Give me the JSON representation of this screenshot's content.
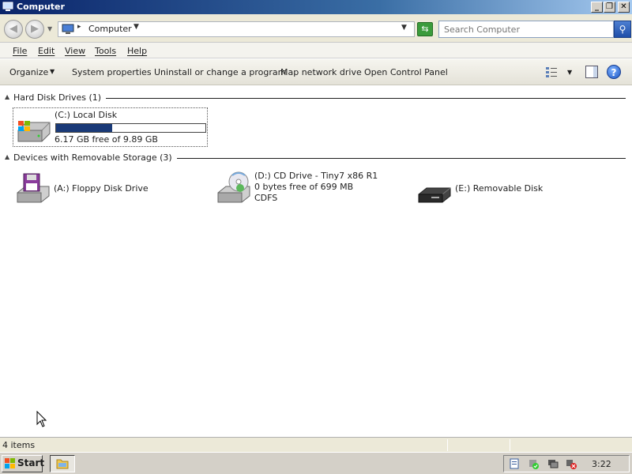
{
  "window": {
    "title": "Computer",
    "min_glyph": "_",
    "max_glyph": "❐",
    "close_glyph": "✕"
  },
  "address": {
    "location": "Computer",
    "search_placeholder": "Search Computer"
  },
  "menu": [
    "File",
    "Edit",
    "View",
    "Tools",
    "Help"
  ],
  "commands": {
    "organize": "Organize",
    "system_properties": "System properties",
    "uninstall": "Uninstall or change a program",
    "map_drive": "Map network drive",
    "control_panel": "Open Control Panel",
    "help_glyph": "?"
  },
  "groups": {
    "hard_disks": {
      "title": "Hard Disk Drives (1)",
      "drives": [
        {
          "name": "(C:) Local Disk",
          "info": "6.17 GB free of 9.89 GB",
          "used_fraction": 0.376,
          "icon": "windows-hard-disk-icon"
        }
      ]
    },
    "removable": {
      "title": "Devices with Removable Storage (3)",
      "drives": [
        {
          "name": "(A:) Floppy Disk Drive",
          "icon": "floppy-drive-icon"
        },
        {
          "name": "(D:) CD Drive - Tiny7 x86 R1",
          "info": "0 bytes free of 699 MB",
          "info2": "CDFS",
          "icon": "cd-drive-icon"
        },
        {
          "name": "(E:) Removable Disk",
          "icon": "removable-disk-icon"
        }
      ]
    }
  },
  "status": {
    "items": "4 items"
  },
  "taskbar": {
    "start": "Start",
    "clock": "3:22"
  },
  "colors": {
    "capacity_fill": "#1a3a78",
    "title_bar": "#0a246a"
  }
}
